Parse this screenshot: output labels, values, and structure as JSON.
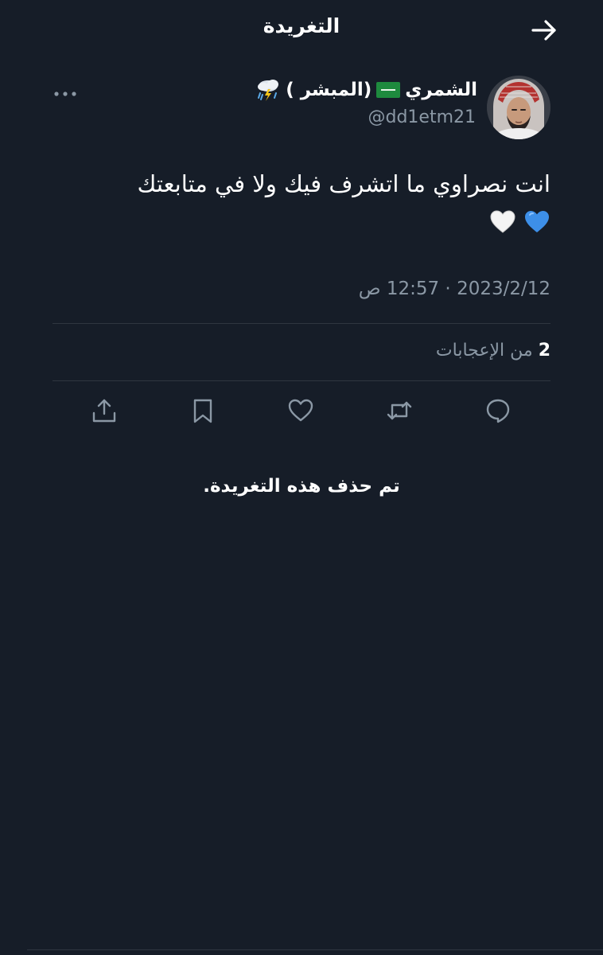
{
  "header": {
    "title": "التغريدة",
    "back_icon": "arrow-right-icon"
  },
  "author": {
    "name": "الشمري",
    "tag": "(المبشر )",
    "flag_icon": "saudi-flag-icon",
    "weather_icon": "cloud-lightning-rain-icon",
    "handle": "@dd1etm21"
  },
  "tweet": {
    "text": "انت نصراوي ما اتشرف فيك ولا في متابعتك",
    "emojis": [
      "blue-heart-icon",
      "white-heart-icon"
    ],
    "timestamp": "2023/2/12 · 12:57 ص"
  },
  "stats": {
    "likes_count": "2",
    "likes_label": "من الإعجابات"
  },
  "actions": {
    "reply_icon": "reply-icon",
    "retweet_icon": "retweet-icon",
    "like_icon": "heart-icon",
    "bookmark_icon": "bookmark-icon",
    "share_icon": "share-icon"
  },
  "notice": {
    "deleted": "تم حذف هذه التغريدة."
  },
  "colors": {
    "background": "#161d28",
    "text_primary": "#ffffff",
    "text_secondary": "#8b98a5",
    "divider": "#2f3640"
  }
}
